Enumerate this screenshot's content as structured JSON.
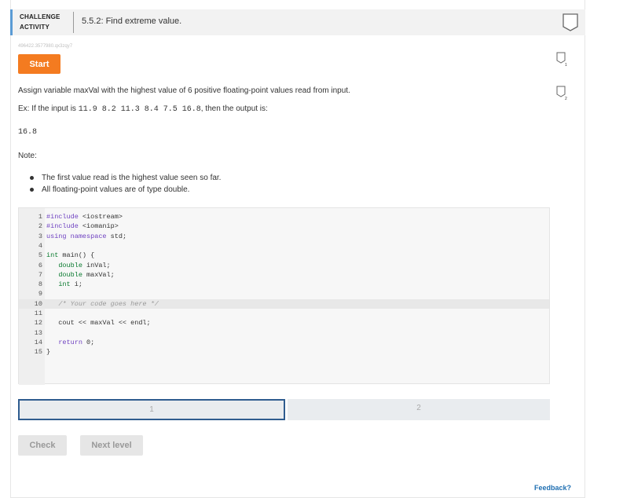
{
  "header": {
    "label_line1": "CHALLENGE",
    "label_line2": "ACTIVITY",
    "title": "5.5.2: Find extreme value."
  },
  "activity": {
    "code_id": "496422.3577980.qx3zqy7",
    "start_label": "Start"
  },
  "prompt": {
    "text": "Assign variable maxVal with the highest value of 6 positive floating-point values read from input.",
    "example_prefix": "Ex: If the input is ",
    "example_input": "11.9 8.2 11.3 8.4 7.5 16.8",
    "example_suffix": ", then the output is:",
    "output": "16.8",
    "note_label": "Note:",
    "notes": [
      "The first value read is the highest value seen so far.",
      "All floating-point values are of type double."
    ]
  },
  "editor": {
    "lines": [
      {
        "n": "1",
        "code": "#include <iostream>"
      },
      {
        "n": "2",
        "code": "#include <iomanip>"
      },
      {
        "n": "3",
        "code": "using namespace std;"
      },
      {
        "n": "4",
        "code": ""
      },
      {
        "n": "5",
        "code": "int main() {"
      },
      {
        "n": "6",
        "code": "   double inVal;"
      },
      {
        "n": "7",
        "code": "   double maxVal;"
      },
      {
        "n": "8",
        "code": "   int i;"
      },
      {
        "n": "9",
        "code": ""
      },
      {
        "n": "10",
        "code": "   /* Your code goes here */"
      },
      {
        "n": "11",
        "code": ""
      },
      {
        "n": "12",
        "code": "   cout << maxVal << endl;"
      },
      {
        "n": "13",
        "code": ""
      },
      {
        "n": "14",
        "code": "   return 0;"
      },
      {
        "n": "15",
        "code": "}"
      }
    ]
  },
  "levels": {
    "level1": "1",
    "level2": "2"
  },
  "buttons": {
    "check": "Check",
    "next": "Next level"
  },
  "feedback_label": "Feedback?",
  "sidebar": {
    "level_markers": [
      "1",
      "2"
    ]
  },
  "icons": {
    "badge": "completion-badge-icon",
    "level": "level-marker-icon"
  },
  "colors": {
    "accent": "#5b9bd5",
    "start": "#f47b20",
    "active_level_border": "#2f5c8f",
    "feedback": "#1f6fb2"
  }
}
